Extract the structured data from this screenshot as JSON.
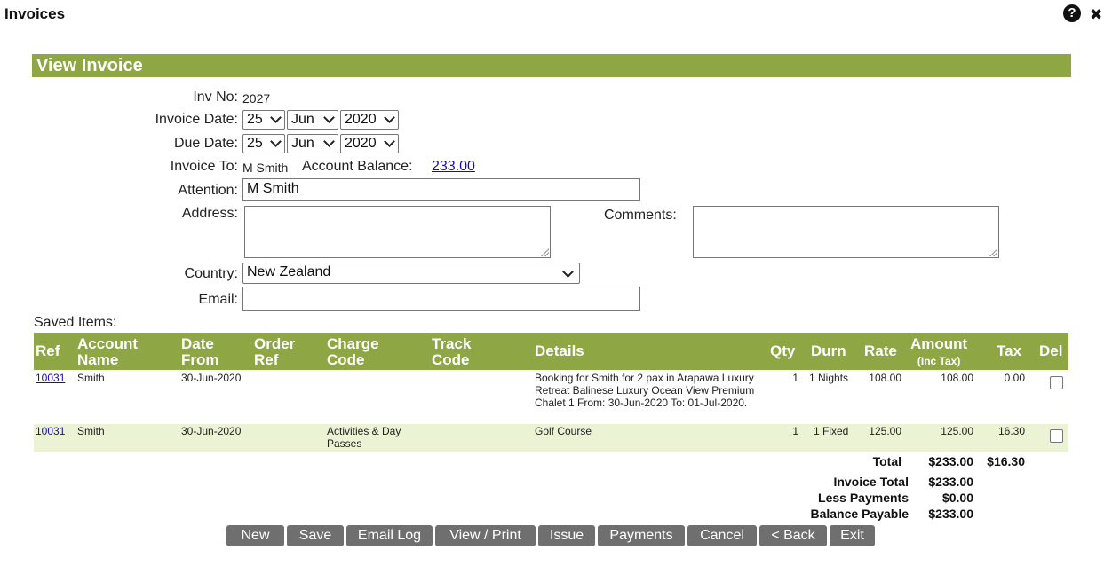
{
  "window": {
    "title": "Invoices",
    "help": "?",
    "close": "✖"
  },
  "banner": {
    "title": "View Invoice"
  },
  "form": {
    "inv_no_label": "Inv No:",
    "inv_no": "2027",
    "invoice_date_label": "Invoice Date:",
    "invoice_date": {
      "day": "25",
      "month": "Jun",
      "year": "2020"
    },
    "due_date_label": "Due Date:",
    "due_date": {
      "day": "25",
      "month": "Jun",
      "year": "2020"
    },
    "invoice_to_label": "Invoice To:",
    "invoice_to": "M Smith",
    "account_balance_label": "Account Balance:",
    "account_balance": "233.00",
    "attention_label": "Attention:",
    "attention": "M Smith",
    "address_label": "Address:",
    "address": "",
    "comments_label": "Comments:",
    "comments": "",
    "country_label": "Country:",
    "country": "New Zealand",
    "email_label": "Email:",
    "email": ""
  },
  "saved_items": {
    "label": "Saved Items:",
    "headers": {
      "ref": "Ref",
      "account_name_1": "Account",
      "account_name_2": "Name",
      "date_from_1": "Date",
      "date_from_2": "From",
      "order_ref_1": "Order",
      "order_ref_2": "Ref",
      "charge_code_1": "Charge",
      "charge_code_2": "Code",
      "track_code_1": "Track",
      "track_code_2": "Code",
      "details": "Details",
      "qty": "Qty",
      "durn": "Durn",
      "rate": "Rate",
      "amount_1": "Amount",
      "amount_2": "(Inc Tax)",
      "tax": "Tax",
      "del": "Del"
    },
    "rows": [
      {
        "ref": "10031",
        "account_name": "Smith",
        "date_from": "30-Jun-2020",
        "order_ref": "",
        "charge_code": "",
        "track_code": "",
        "details": "Booking for Smith for 2 pax in Arapawa Luxury Retreat Balinese Luxury Ocean View Premium Chalet 1 From: 30-Jun-2020 To: 01-Jul-2020.",
        "qty": "1",
        "durn": "1 Nights",
        "rate": "108.00",
        "amount": "108.00",
        "tax": "0.00"
      },
      {
        "ref": "10031",
        "account_name": "Smith",
        "date_from": "30-Jun-2020",
        "order_ref": "",
        "charge_code": "Activities & Day Passes",
        "track_code": "",
        "details": "Golf Course",
        "qty": "1",
        "durn": "1 Fixed",
        "rate": "125.00",
        "amount": "125.00",
        "tax": "16.30"
      }
    ],
    "colors": {
      "header_bg": "#8ea644",
      "alt_row_bg": "#eaf3d4"
    }
  },
  "totals": {
    "total_label": "Total",
    "total_amount": "$233.00",
    "total_tax": "$16.30",
    "invoice_total_label": "Invoice Total",
    "invoice_total": "$233.00",
    "less_payments_label": "Less Payments",
    "less_payments": "$0.00",
    "balance_payable_label": "Balance Payable",
    "balance_payable": "$233.00"
  },
  "buttons": [
    "New",
    "Save",
    "Email Log",
    "View / Print",
    "Issue",
    "Payments",
    "Cancel",
    "< Back",
    "Exit"
  ]
}
